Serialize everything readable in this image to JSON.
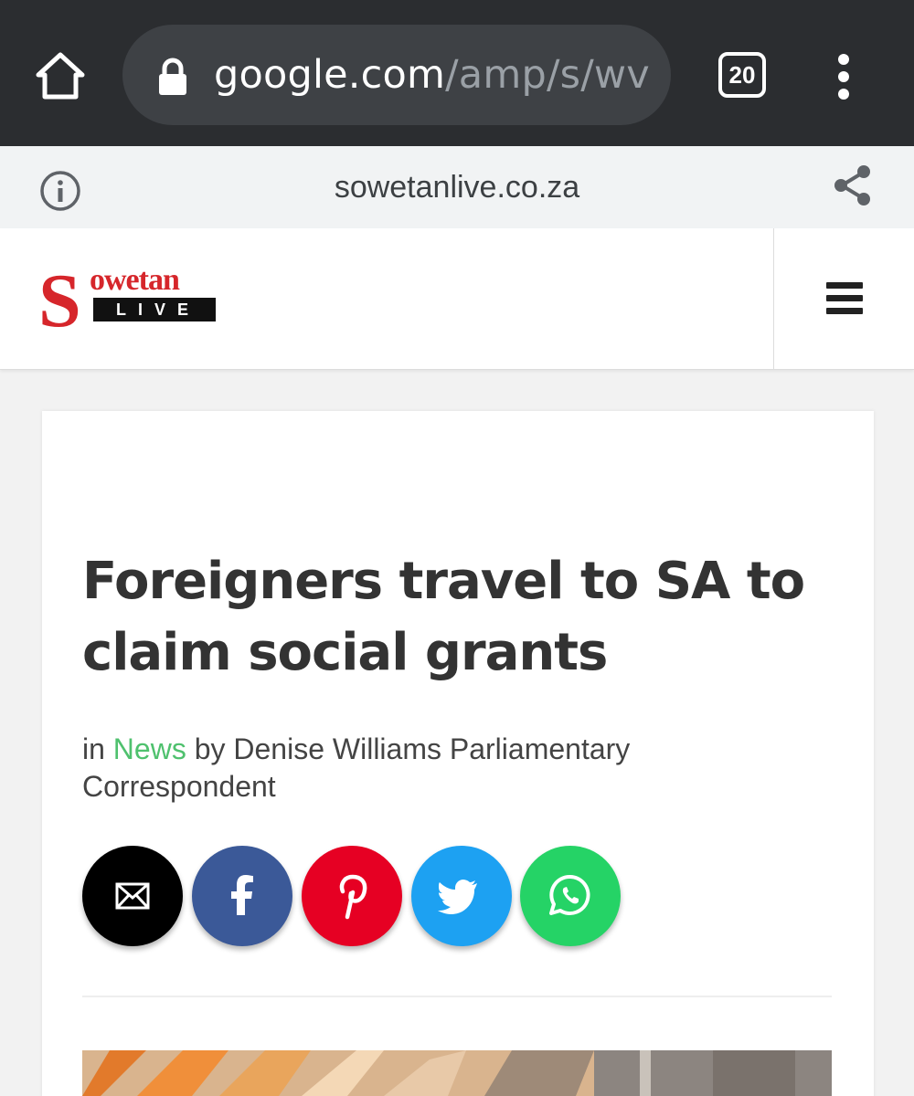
{
  "browser": {
    "url_host": "google.com",
    "url_path": "/amp/s/wv",
    "tab_count": "20",
    "home_icon": "home-icon",
    "lock_icon": "lock-icon",
    "menu_icon": "more-vert-icon"
  },
  "amp_bar": {
    "domain": "sowetanlive.co.za",
    "info_icon": "info-icon",
    "share_icon": "share-icon"
  },
  "site": {
    "logo_initial": "S",
    "logo_word": "owetan",
    "logo_live": "LIVE",
    "menu_icon": "hamburger-menu-icon",
    "brand_color": "#d6262b"
  },
  "article": {
    "headline": "Foreigners travel to SA to claim social grants",
    "byline_prefix": "in ",
    "category": "News",
    "byline_author": " by Denise Williams Parliamentary Correspondent",
    "category_color": "#4fc16e"
  },
  "share_buttons": [
    {
      "network": "email",
      "icon": "envelope-icon",
      "color": "#000000"
    },
    {
      "network": "facebook",
      "icon": "facebook-icon",
      "color": "#3b5998"
    },
    {
      "network": "pinterest",
      "icon": "pinterest-icon",
      "color": "#e60023"
    },
    {
      "network": "twitter",
      "icon": "twitter-icon",
      "color": "#1da1f2"
    },
    {
      "network": "whatsapp",
      "icon": "whatsapp-icon",
      "color": "#25d366"
    }
  ]
}
